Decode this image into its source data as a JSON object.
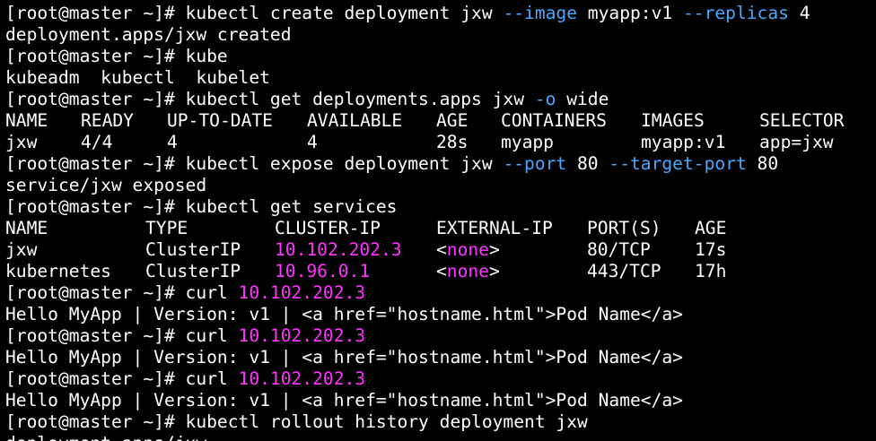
{
  "colors": {
    "background": "#000000",
    "text": "#ffffff",
    "flag": "#4aa8ff",
    "magenta": "#ff33ff"
  },
  "lines": [
    {
      "type": "cmd",
      "segments": [
        {
          "text": "[root@master ~]# kubectl create deployment jxw ",
          "color": "text"
        },
        {
          "text": "--image",
          "color": "flag"
        },
        {
          "text": " myapp:v1 ",
          "color": "text"
        },
        {
          "text": "--replicas",
          "color": "flag"
        },
        {
          "text": " 4",
          "color": "text"
        }
      ]
    },
    {
      "type": "output",
      "segments": [
        {
          "text": "deployment.apps/jxw created",
          "color": "text"
        }
      ]
    },
    {
      "type": "cmd",
      "segments": [
        {
          "text": "[root@master ~]# kube",
          "color": "text"
        }
      ]
    },
    {
      "type": "output",
      "segments": [
        {
          "text": "kubeadm  kubectl  kubelet",
          "color": "text"
        }
      ]
    },
    {
      "type": "cmd",
      "segments": [
        {
          "text": "[root@master ~]# kubectl get deployments.apps jxw ",
          "color": "text"
        },
        {
          "text": "-o",
          "color": "flag"
        },
        {
          "text": " wide",
          "color": "text"
        }
      ]
    },
    {
      "type": "table",
      "cells": [
        {
          "text": "NAME",
          "col": 0,
          "color": "text"
        },
        {
          "text": "READY",
          "col": 1,
          "color": "text"
        },
        {
          "text": "UP-TO-DATE",
          "col": 2,
          "color": "text"
        },
        {
          "text": "AVAILABLE",
          "col": 3,
          "color": "text"
        },
        {
          "text": "AGE",
          "col": 4,
          "color": "text"
        },
        {
          "text": "CONTAINERS",
          "col": 5,
          "color": "text"
        },
        {
          "text": "IMAGES",
          "col": 6,
          "color": "text"
        },
        {
          "text": "SELECTOR",
          "col": 7,
          "color": "text"
        }
      ]
    },
    {
      "type": "table",
      "cells": [
        {
          "text": "jxw",
          "col": 0,
          "color": "text"
        },
        {
          "text": "4/4",
          "col": 1,
          "color": "text"
        },
        {
          "text": "4",
          "col": 2,
          "color": "text"
        },
        {
          "text": "4",
          "col": 3,
          "color": "text"
        },
        {
          "text": "28s",
          "col": 4,
          "color": "text"
        },
        {
          "text": "myapp",
          "col": 5,
          "color": "text"
        },
        {
          "text": "myapp:v1",
          "col": 6,
          "color": "text"
        },
        {
          "text": "app=jxw",
          "col": 7,
          "color": "text"
        }
      ]
    },
    {
      "type": "cmd",
      "segments": [
        {
          "text": "[root@master ~]# kubectl expose deployment jxw ",
          "color": "text"
        },
        {
          "text": "--port",
          "color": "flag"
        },
        {
          "text": " 80 ",
          "color": "text"
        },
        {
          "text": "--target-port",
          "color": "flag"
        },
        {
          "text": " 80",
          "color": "text"
        }
      ]
    },
    {
      "type": "output",
      "segments": [
        {
          "text": "service/jxw exposed",
          "color": "text"
        }
      ]
    },
    {
      "type": "cmd",
      "segments": [
        {
          "text": "[root@master ~]# kubectl get services",
          "color": "text"
        }
      ]
    },
    {
      "type": "table",
      "cells": [
        {
          "text": "NAME",
          "col": 0,
          "color": "text"
        },
        {
          "text": "TYPE",
          "col": 1,
          "color": "text"
        },
        {
          "text": "CLUSTER-IP",
          "col": 2,
          "color": "text"
        },
        {
          "text": "EXTERNAL-IP",
          "col": 3,
          "color": "text"
        },
        {
          "text": "PORT(S)",
          "col": 4,
          "color": "text"
        },
        {
          "text": "AGE",
          "col": 5,
          "color": "text"
        }
      ]
    },
    {
      "type": "table",
      "cells": [
        {
          "text": "jxw",
          "col": 0,
          "color": "text"
        },
        {
          "text": "ClusterIP",
          "col": 1,
          "color": "text"
        },
        {
          "text": "10.102.202.3",
          "col": 2,
          "color": "magenta"
        },
        {
          "text": "<",
          "col": 3,
          "color": "text"
        },
        {
          "text": "none",
          "col": 3,
          "offset": 1,
          "color": "magenta"
        },
        {
          "text": ">",
          "col": 3,
          "offset": 5,
          "color": "text"
        },
        {
          "text": "80/TCP",
          "col": 4,
          "color": "text"
        },
        {
          "text": "17s",
          "col": 5,
          "color": "text"
        }
      ]
    },
    {
      "type": "table",
      "cells": [
        {
          "text": "kubernetes",
          "col": 0,
          "color": "text"
        },
        {
          "text": "ClusterIP",
          "col": 1,
          "color": "text"
        },
        {
          "text": "10.96.0.1",
          "col": 2,
          "color": "magenta"
        },
        {
          "text": "<",
          "col": 3,
          "color": "text"
        },
        {
          "text": "none",
          "col": 3,
          "offset": 1,
          "color": "magenta"
        },
        {
          "text": ">",
          "col": 3,
          "offset": 5,
          "color": "text"
        },
        {
          "text": "443/TCP",
          "col": 4,
          "color": "text"
        },
        {
          "text": "17h",
          "col": 5,
          "color": "text"
        }
      ]
    },
    {
      "type": "cmd",
      "segments": [
        {
          "text": "[root@master ~]# curl ",
          "color": "text"
        },
        {
          "text": "10.102.202.3",
          "color": "magenta"
        }
      ]
    },
    {
      "type": "output",
      "segments": [
        {
          "text": "Hello MyApp | Version: v1 | <a href=\"hostname.html\">Pod Name</a>",
          "color": "text"
        }
      ]
    },
    {
      "type": "cmd",
      "segments": [
        {
          "text": "[root@master ~]# curl ",
          "color": "text"
        },
        {
          "text": "10.102.202.3",
          "color": "magenta"
        }
      ]
    },
    {
      "type": "output",
      "segments": [
        {
          "text": "Hello MyApp | Version: v1 | <a href=\"hostname.html\">Pod Name</a>",
          "color": "text"
        }
      ]
    },
    {
      "type": "cmd",
      "segments": [
        {
          "text": "[root@master ~]# curl ",
          "color": "text"
        },
        {
          "text": "10.102.202.3",
          "color": "magenta"
        }
      ]
    },
    {
      "type": "output",
      "segments": [
        {
          "text": "Hello MyApp | Version: v1 | <a href=\"hostname.html\">Pod Name</a>",
          "color": "text"
        }
      ]
    },
    {
      "type": "cmd",
      "segments": [
        {
          "text": "[root@master ~]# kubectl rollout history deployment jxw",
          "color": "text"
        }
      ]
    },
    {
      "type": "output",
      "segments": [
        {
          "text": "deployment.apps/jxw",
          "color": "text"
        }
      ]
    }
  ]
}
